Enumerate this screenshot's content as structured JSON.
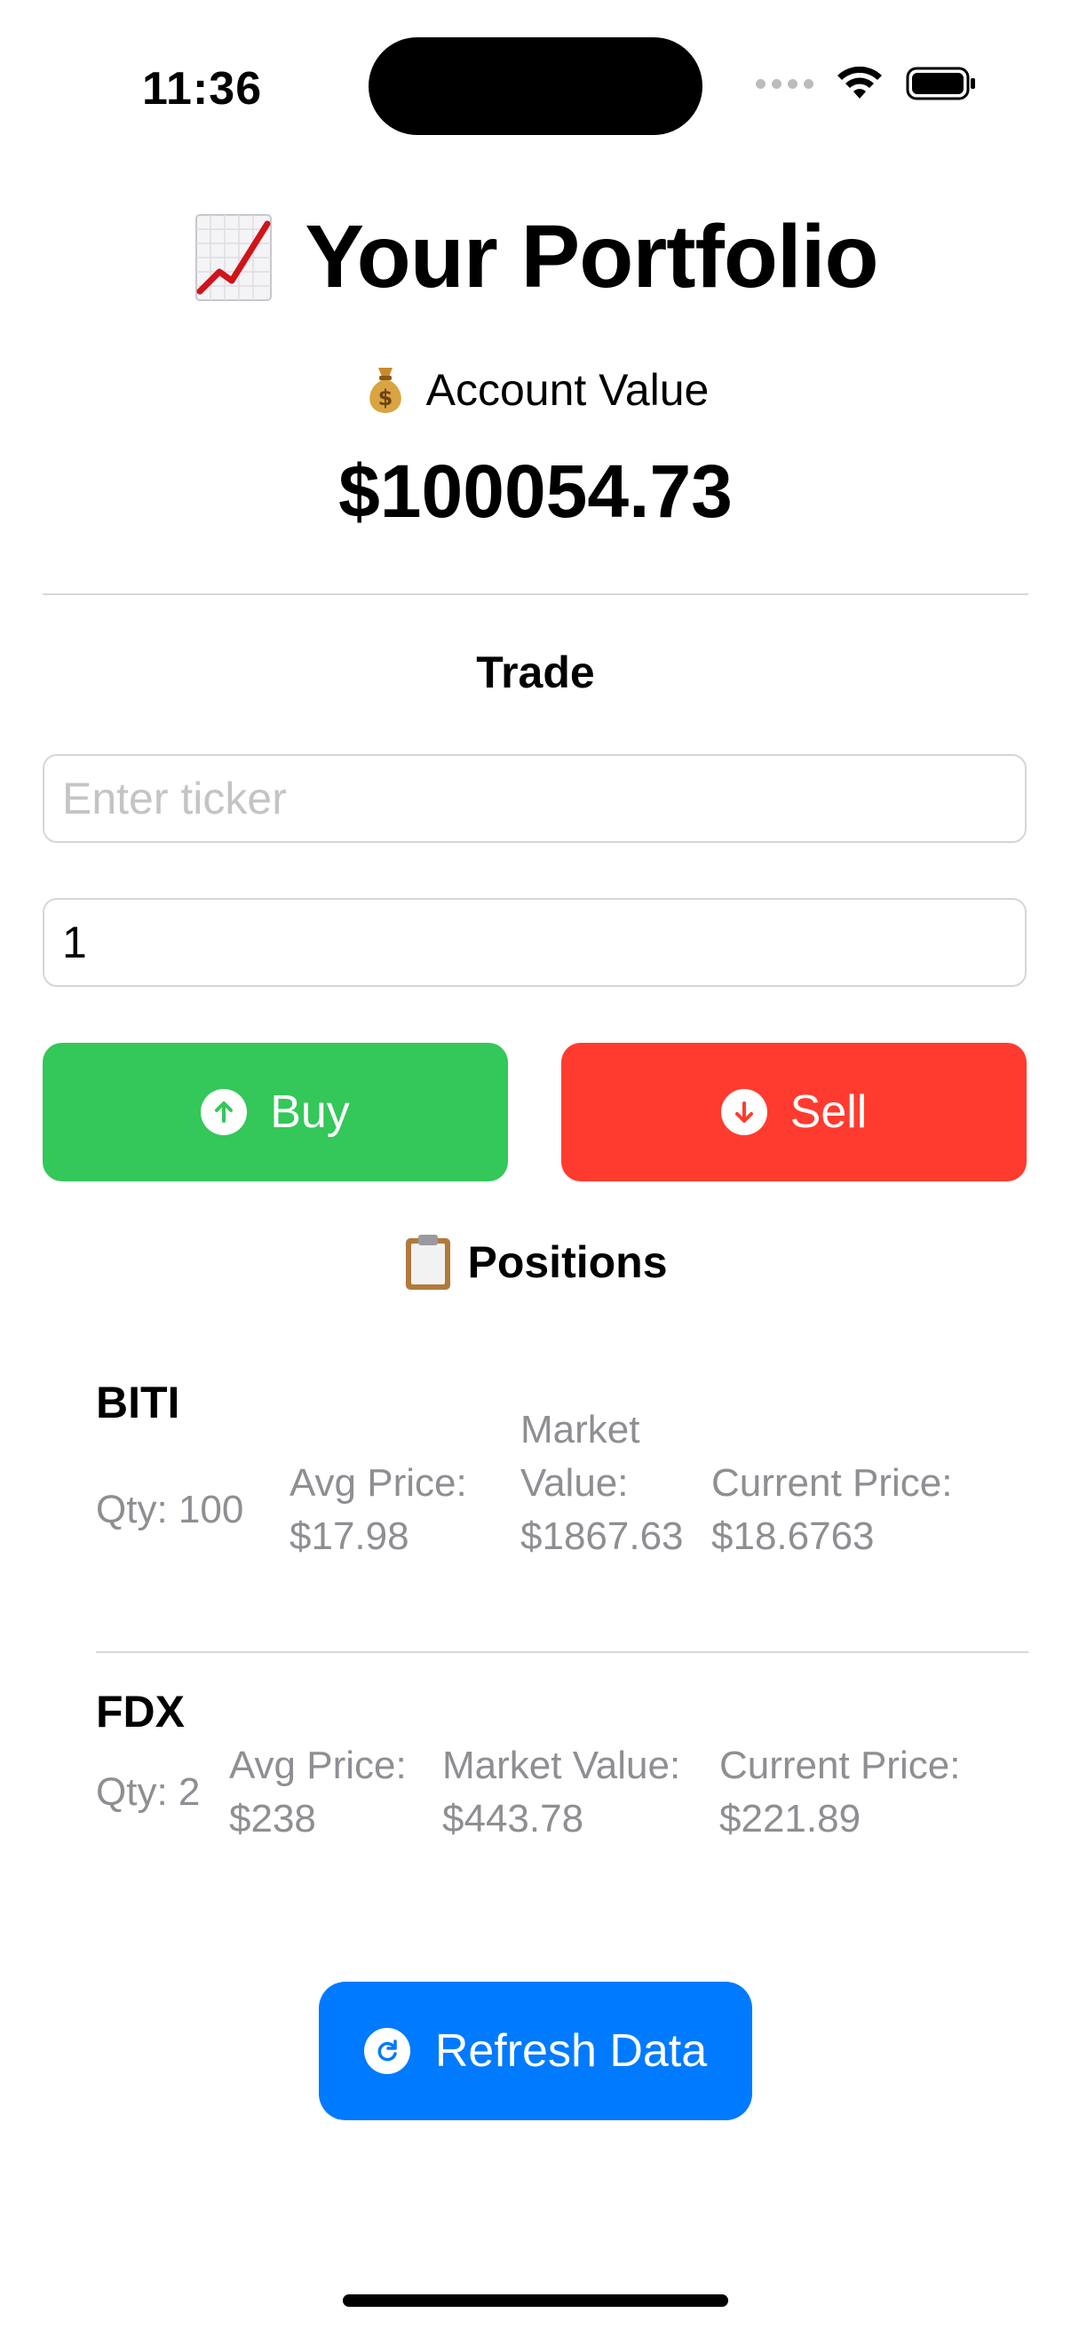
{
  "status_bar": {
    "time": "11:36"
  },
  "header": {
    "title_emoji": "chart-increasing-icon",
    "title": "Your Portfolio",
    "account_label": "Account Value",
    "account_value": "$100054.73"
  },
  "trade": {
    "title": "Trade",
    "ticker_placeholder": "Enter ticker",
    "ticker_value": "",
    "quantity_value": "1",
    "buy_label": "Buy",
    "sell_label": "Sell"
  },
  "positions": {
    "title": "Positions",
    "items": [
      {
        "ticker": "BITI",
        "qty": "Qty: 100",
        "avg_label": "Avg Price:",
        "avg_value": "$17.98",
        "market_label_1": "Market",
        "market_label_2": "Value:",
        "market_value": "$1867.63",
        "current_label": "Current Price:",
        "current_value": "$18.6763"
      },
      {
        "ticker": "FDX",
        "qty": "Qty: 2",
        "avg_label": "Avg Price:",
        "avg_value": "$238",
        "market_label": "Market Value:",
        "market_value": "$443.78",
        "current_label": "Current Price:",
        "current_value": "$221.89"
      }
    ]
  },
  "refresh": {
    "label": "Refresh Data"
  },
  "colors": {
    "buy": "#34c759",
    "sell": "#ff3b30",
    "refresh": "#007aff",
    "secondary_text": "#8e8e93"
  }
}
